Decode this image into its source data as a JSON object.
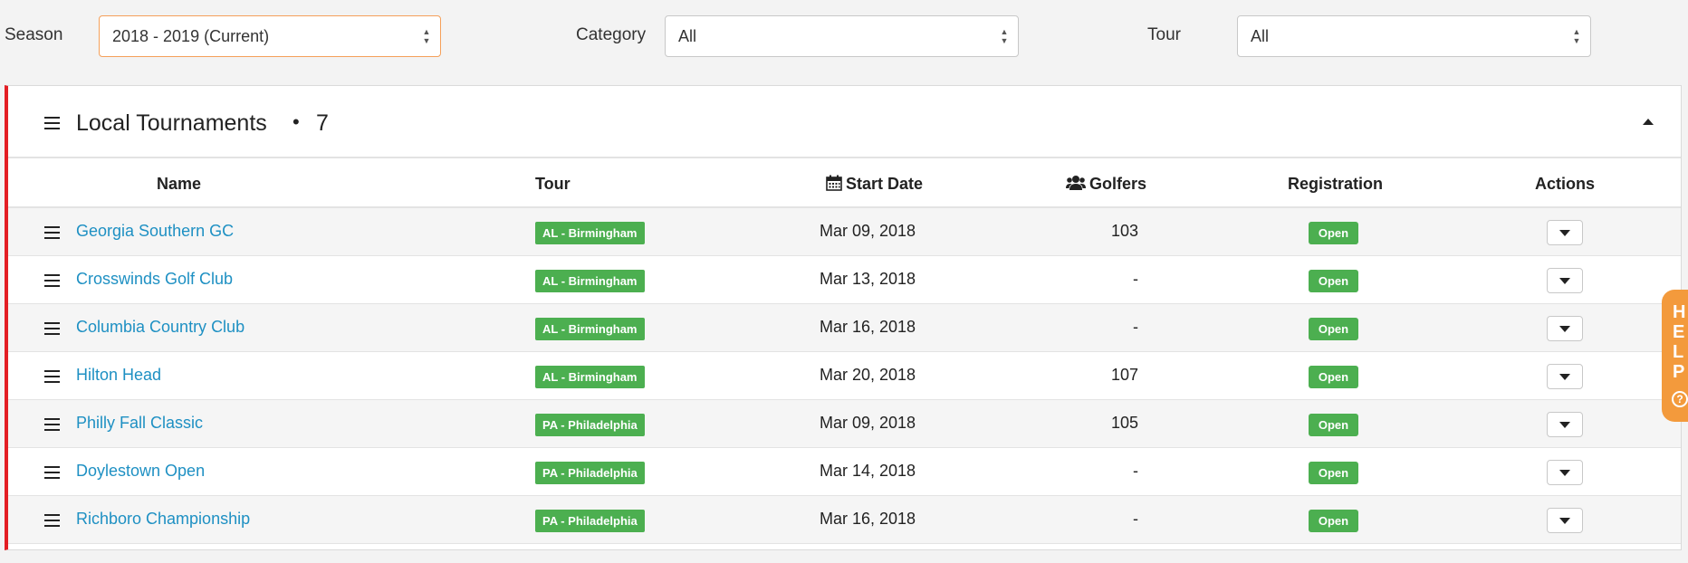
{
  "filters": {
    "season": {
      "label": "Season",
      "value": "2018 - 2019 (Current)"
    },
    "category": {
      "label": "Category",
      "value": "All"
    },
    "tour": {
      "label": "Tour",
      "value": "All"
    }
  },
  "panel": {
    "title": "Local Tournaments",
    "separator": "•",
    "count": "7"
  },
  "table": {
    "columns": {
      "name": "Name",
      "tour": "Tour",
      "start_date": "Start Date",
      "golfers": "Golfers",
      "registration": "Registration",
      "actions": "Actions"
    },
    "rows": [
      {
        "name": "Georgia Southern GC",
        "tour": "AL - Birmingham",
        "start_date": "Mar 09, 2018",
        "golfers": "103",
        "registration": "Open"
      },
      {
        "name": "Crosswinds Golf Club",
        "tour": "AL - Birmingham",
        "start_date": "Mar 13, 2018",
        "golfers": "-",
        "registration": "Open"
      },
      {
        "name": "Columbia Country Club",
        "tour": "AL - Birmingham",
        "start_date": "Mar 16, 2018",
        "golfers": "-",
        "registration": "Open"
      },
      {
        "name": "Hilton Head",
        "tour": "AL - Birmingham",
        "start_date": "Mar 20, 2018",
        "golfers": "107",
        "registration": "Open"
      },
      {
        "name": "Philly Fall Classic",
        "tour": "PA - Philadelphia",
        "start_date": "Mar 09, 2018",
        "golfers": "105",
        "registration": "Open"
      },
      {
        "name": "Doylestown Open",
        "tour": "PA - Philadelphia",
        "start_date": "Mar 14, 2018",
        "golfers": "-",
        "registration": "Open"
      },
      {
        "name": "Richboro Championship",
        "tour": "PA - Philadelphia",
        "start_date": "Mar 16, 2018",
        "golfers": "-",
        "registration": "Open"
      }
    ]
  },
  "help": {
    "letters": [
      "H",
      "E",
      "L",
      "P"
    ],
    "icon": "question-circle-icon",
    "icon_glyph": "?"
  },
  "colors": {
    "panel_accent": "#e31e24",
    "badge_green": "#4caf50",
    "link_blue": "#1e90c3",
    "help_orange": "#f39a3c",
    "active_select_border": "#f5a05a"
  }
}
